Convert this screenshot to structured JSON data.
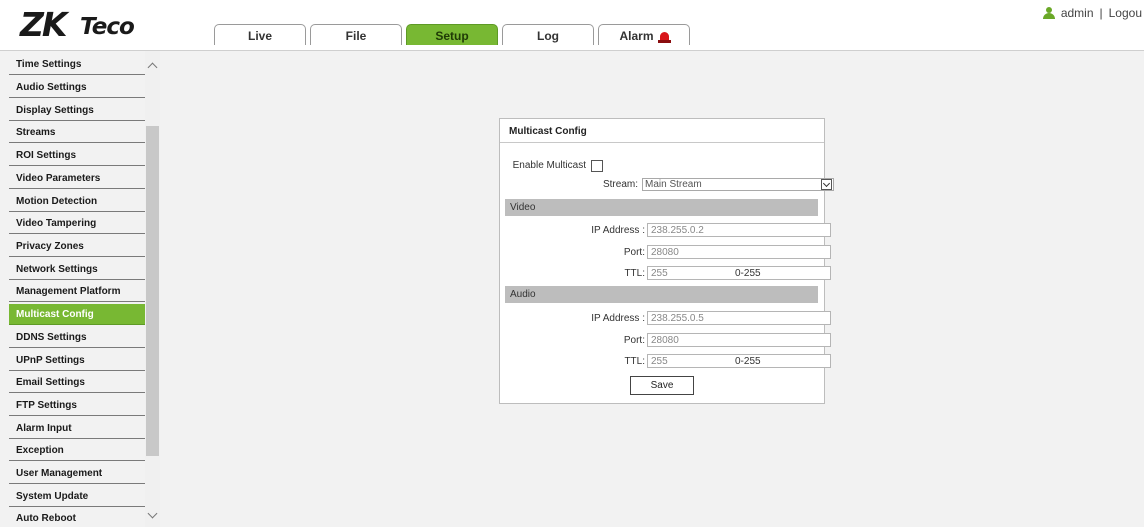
{
  "logo": {
    "primary": "ZK",
    "secondary": "Teco"
  },
  "tabs": [
    {
      "label": "Live"
    },
    {
      "label": "File"
    },
    {
      "label": "Setup",
      "active": true
    },
    {
      "label": "Log"
    },
    {
      "label": "Alarm",
      "icon": "alarm-siren-icon"
    }
  ],
  "user": {
    "name": "admin",
    "separator": "|",
    "logout": "Logou"
  },
  "sidebar": {
    "items": [
      {
        "label": "Time Settings"
      },
      {
        "label": "Audio Settings"
      },
      {
        "label": "Display Settings"
      },
      {
        "label": "Streams"
      },
      {
        "label": "ROI Settings"
      },
      {
        "label": "Video Parameters"
      },
      {
        "label": "Motion Detection"
      },
      {
        "label": "Video Tampering"
      },
      {
        "label": "Privacy Zones"
      },
      {
        "label": "Network Settings"
      },
      {
        "label": "Management Platform"
      },
      {
        "label": "Multicast Config",
        "active": true
      },
      {
        "label": "DDNS Settings"
      },
      {
        "label": "UPnP Settings"
      },
      {
        "label": "Email Settings"
      },
      {
        "label": "FTP Settings"
      },
      {
        "label": "Alarm Input"
      },
      {
        "label": "Exception"
      },
      {
        "label": "User Management"
      },
      {
        "label": "System Update"
      },
      {
        "label": "Auto Reboot"
      }
    ]
  },
  "panel": {
    "title": "Multicast Config",
    "enable_label": "Enable Multicast",
    "enable_checked": false,
    "stream_label": "Stream:",
    "stream_value": "Main Stream",
    "video": {
      "section": "Video",
      "ip_label": "IP Address :",
      "ip_value": "238.255.0.2",
      "port_label": "Port:",
      "port_value": "28080",
      "ttl_label": "TTL:",
      "ttl_value": "255",
      "ttl_range": "0-255"
    },
    "audio": {
      "section": "Audio",
      "ip_label": "IP Address :",
      "ip_value": "238.255.0.5",
      "port_label": "Port:",
      "port_value": "28080",
      "ttl_label": "TTL:",
      "ttl_value": "255",
      "ttl_range": "0-255"
    },
    "save_label": "Save"
  },
  "colors": {
    "accent": "#78b833",
    "alarm": "#d8161a",
    "section_bar": "#bdbdbd"
  }
}
